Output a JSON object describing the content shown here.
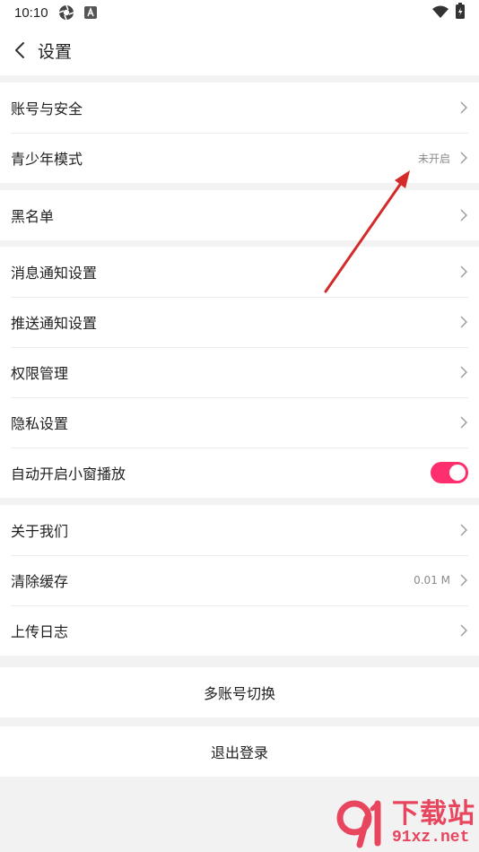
{
  "status_bar": {
    "time": "10:10",
    "icons": [
      "aperture-icon",
      "a-letter-icon",
      "wifi-icon",
      "battery-icon"
    ]
  },
  "header": {
    "title": "设置",
    "back_icon": "chevron-left-icon"
  },
  "groups": {
    "account": {
      "account_security": "账号与安全",
      "youth_mode": "青少年模式",
      "youth_mode_status": "未开启"
    },
    "blacklist": {
      "label": "黑名单"
    },
    "notifications": {
      "message_notify": "消息通知设置",
      "push_notify": "推送通知设置",
      "permission": "权限管理",
      "privacy": "隐私设置",
      "auto_pip": "自动开启小窗播放",
      "auto_pip_enabled": "true"
    },
    "about": {
      "about_us": "关于我们",
      "clear_cache": "清除缓存",
      "cache_size": "0.01 M",
      "upload_log": "上传日志"
    }
  },
  "actions": {
    "switch_account": "多账号切换",
    "logout": "退出登录"
  },
  "colors": {
    "accent": "#ff2f6d",
    "annotation_arrow": "#d42a2a",
    "watermark": "#e8455e"
  },
  "watermark": {
    "main": "下载站",
    "sub": "91xz.net"
  }
}
